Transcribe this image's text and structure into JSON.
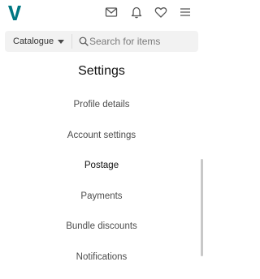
{
  "header": {
    "brand": "Vinted",
    "icons": [
      "mail-icon",
      "bell-icon",
      "heart-icon",
      "menu-icon"
    ],
    "brand_color": "#007782"
  },
  "search": {
    "category_label": "Catalogue",
    "placeholder": "Search for items",
    "value": ""
  },
  "page": {
    "title": "Settings"
  },
  "menu": {
    "items": [
      {
        "label": "Profile details",
        "active": false
      },
      {
        "label": "Account settings",
        "active": false
      },
      {
        "label": "Postage",
        "active": true
      },
      {
        "label": "Payments",
        "active": false
      },
      {
        "label": "Bundle discounts",
        "active": false
      },
      {
        "label": "Notifications",
        "active": false
      }
    ]
  }
}
